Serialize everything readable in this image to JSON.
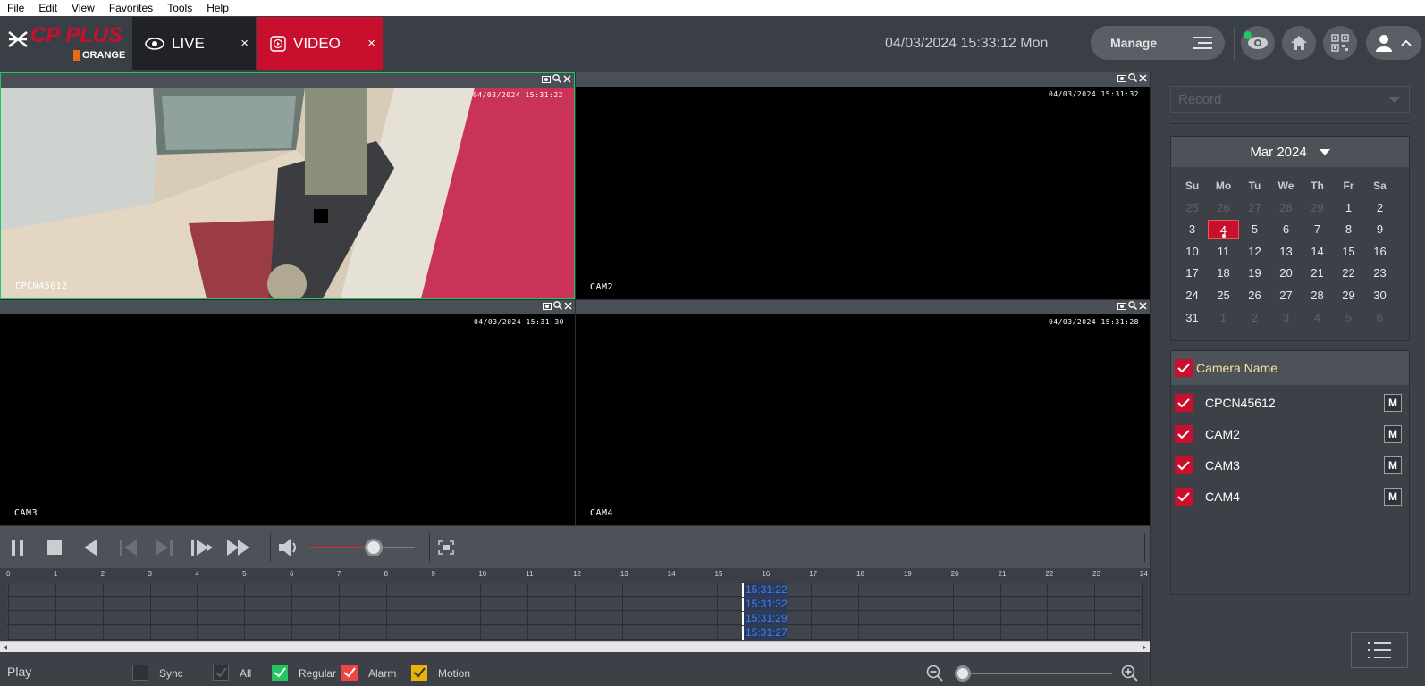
{
  "menubar": {
    "items": [
      "File",
      "Edit",
      "View",
      "Favorites",
      "Tools",
      "Help"
    ]
  },
  "brand": {
    "name": "CP PLUS",
    "sub": "ORANGE",
    "color": "#c8102e"
  },
  "tabs": [
    {
      "label": "LIVE",
      "icon": "eye-icon",
      "close": "×"
    },
    {
      "label": "VIDEO",
      "icon": "play-icon",
      "close": "×"
    }
  ],
  "header": {
    "datetime": "04/03/2024 15:33:12 Mon",
    "manage_label": "Manage"
  },
  "panes": [
    {
      "camera": "CPCN45612",
      "timestamp": "04/03/2024 15:31:22"
    },
    {
      "camera": "CAM2",
      "timestamp": "04/03/2024 15:31:32"
    },
    {
      "camera": "CAM3",
      "timestamp": "04/03/2024 15:31:30"
    },
    {
      "camera": "CAM4",
      "timestamp": "04/03/2024 15:31:28"
    }
  ],
  "playback": {
    "volume_fraction": 0.62
  },
  "timeline": {
    "hours": [
      "0",
      "1",
      "2",
      "3",
      "4",
      "5",
      "6",
      "7",
      "8",
      "9",
      "10",
      "11",
      "12",
      "13",
      "14",
      "15",
      "16",
      "17",
      "18",
      "19",
      "20",
      "21",
      "22",
      "23",
      "24"
    ],
    "markers": [
      "15:31:22",
      "15:31:32",
      "15:31:29",
      "15:31:27"
    ]
  },
  "bottom": {
    "play_label": "Play",
    "sync_label": "Sync",
    "all_label": "All",
    "regular_label": "Regular",
    "alarm_label": "Alarm",
    "motion_label": "Motion",
    "regular_color": "#22c55e",
    "alarm_color": "#ef4444",
    "motion_color": "#eab308"
  },
  "record": {
    "selected": "Record"
  },
  "calendar": {
    "month": "Mar 2024",
    "weekdays": [
      "Su",
      "Mo",
      "Tu",
      "We",
      "Th",
      "Fr",
      "Sa"
    ],
    "days": [
      "25",
      "26",
      "27",
      "28",
      "29",
      "1",
      "2",
      "3",
      "4",
      "5",
      "6",
      "7",
      "8",
      "9",
      "10",
      "11",
      "12",
      "13",
      "14",
      "15",
      "16",
      "17",
      "18",
      "19",
      "20",
      "21",
      "22",
      "23",
      "24",
      "25",
      "26",
      "27",
      "28",
      "29",
      "30",
      "31",
      "1",
      "2",
      "3",
      "4",
      "5",
      "6"
    ],
    "selected": "4"
  },
  "cameras": {
    "header": "Camera Name",
    "items": [
      "CPCN45612",
      "CAM2",
      "CAM3",
      "CAM4"
    ],
    "m_label": "M"
  }
}
